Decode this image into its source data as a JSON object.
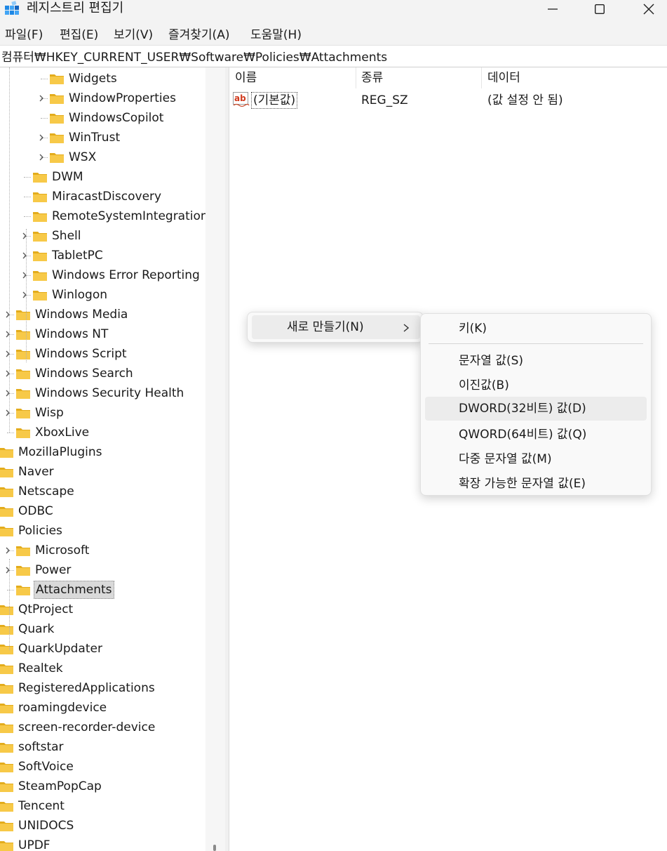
{
  "window": {
    "title": "레지스트리 편집기",
    "icon": "registry-editor-icon"
  },
  "menubar": [
    "파일(F)",
    "편집(E)",
    "보기(V)",
    "즐겨찾기(A)",
    "도움말(H)"
  ],
  "address": "컴퓨터₩HKEY_CURRENT_USER₩Software₩Policies₩Attachments",
  "tree": {
    "items": [
      {
        "label": "Widgets",
        "expandable": false
      },
      {
        "label": "WindowProperties",
        "expandable": true
      },
      {
        "label": "WindowsCopilot",
        "expandable": false
      },
      {
        "label": "WinTrust",
        "expandable": true
      },
      {
        "label": "WSX",
        "expandable": true
      },
      {
        "label": "DWM",
        "expandable": false
      },
      {
        "label": "MiracastDiscovery",
        "expandable": false
      },
      {
        "label": "RemoteSystemIntegration",
        "expandable": false
      },
      {
        "label": "Shell",
        "expandable": true
      },
      {
        "label": "TabletPC",
        "expandable": true
      },
      {
        "label": "Windows Error Reporting",
        "expandable": true
      },
      {
        "label": "Winlogon",
        "expandable": true
      },
      {
        "label": "Windows Media",
        "expandable": true
      },
      {
        "label": "Windows NT",
        "expandable": true
      },
      {
        "label": "Windows Script",
        "expandable": true
      },
      {
        "label": "Windows Search",
        "expandable": true
      },
      {
        "label": "Windows Security Health",
        "expandable": true
      },
      {
        "label": "Wisp",
        "expandable": true
      },
      {
        "label": "XboxLive",
        "expandable": false
      },
      {
        "label": "MozillaPlugins",
        "expandable": false
      },
      {
        "label": "Naver",
        "expandable": false
      },
      {
        "label": "Netscape",
        "expandable": false
      },
      {
        "label": "ODBC",
        "expandable": false
      },
      {
        "label": "Policies",
        "expandable": false
      },
      {
        "label": "Microsoft",
        "expandable": true
      },
      {
        "label": "Power",
        "expandable": true
      },
      {
        "label": "Attachments",
        "expandable": false,
        "selected": true
      },
      {
        "label": "QtProject",
        "expandable": false
      },
      {
        "label": "Quark",
        "expandable": false
      },
      {
        "label": "QuarkUpdater",
        "expandable": false
      },
      {
        "label": "Realtek",
        "expandable": false
      },
      {
        "label": "RegisteredApplications",
        "expandable": false
      },
      {
        "label": "roamingdevice",
        "expandable": false
      },
      {
        "label": "screen-recorder-device",
        "expandable": false
      },
      {
        "label": "softstar",
        "expandable": false
      },
      {
        "label": "SoftVoice",
        "expandable": false
      },
      {
        "label": "SteamPopCap",
        "expandable": false
      },
      {
        "label": "Tencent",
        "expandable": false
      },
      {
        "label": "UNIDOCS",
        "expandable": false
      },
      {
        "label": "UPDF",
        "expandable": false
      }
    ]
  },
  "list": {
    "columns": [
      "이름",
      "종류",
      "데이터"
    ],
    "rows": [
      {
        "name": "(기본값)",
        "type": "REG_SZ",
        "data": "(값 설정 안 됨)",
        "icon": "string-value-icon"
      }
    ]
  },
  "context_menu": {
    "item": "새로 만들기(N)"
  },
  "submenu": {
    "items": [
      "키(K)",
      "문자열 값(S)",
      "이진값(B)",
      "DWORD(32비트) 값(D)",
      "QWORD(64비트) 값(Q)",
      "다중 문자열 값(M)",
      "확장 가능한 문자열 값(E)"
    ],
    "highlighted": "DWORD(32비트) 값(D)"
  },
  "colors": {
    "folder": "#f7c948",
    "folder_dark": "#e3ac1c",
    "selection": "#d9d9d9",
    "menu_highlight": "#ececec"
  }
}
